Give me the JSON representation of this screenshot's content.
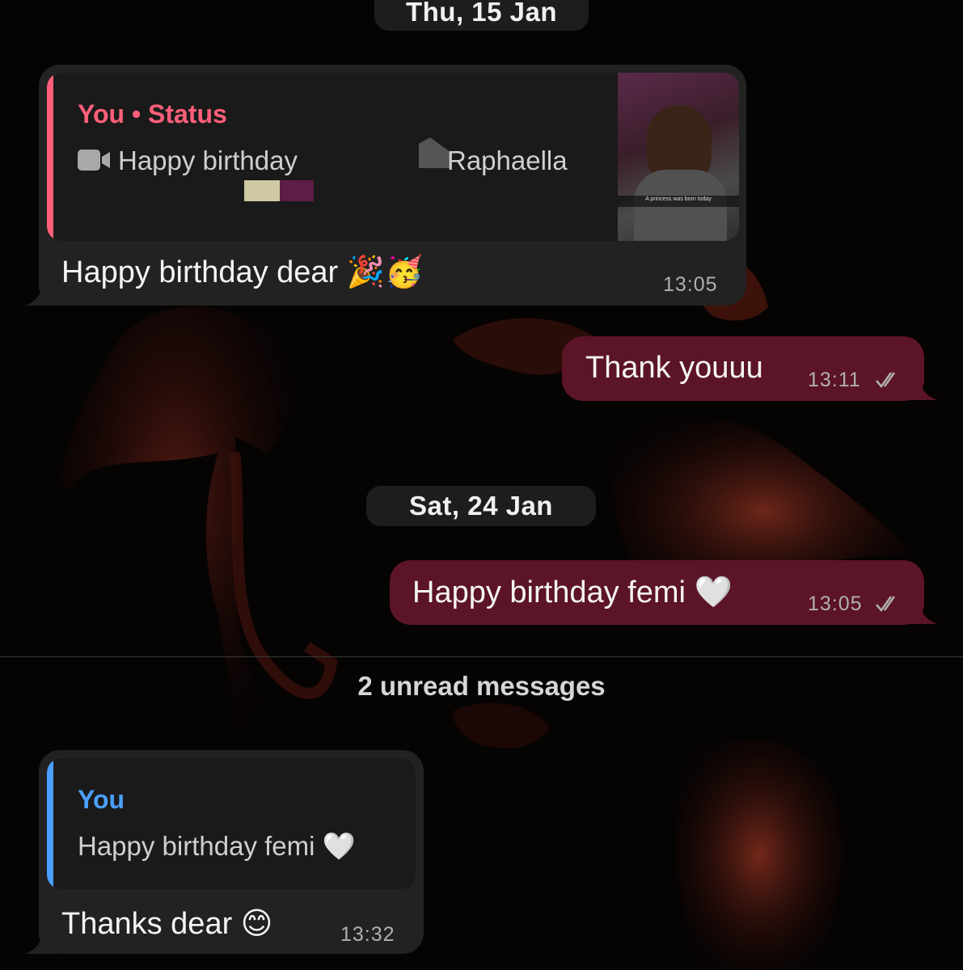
{
  "date_separators": [
    "Thu, 15 Jan",
    "Sat, 24 Jan"
  ],
  "messages": [
    {
      "direction": "incoming",
      "quote": {
        "author": "You • Status",
        "text_prefix": "Happy birthday",
        "text_suffix": "Raphaella",
        "thumbnail_caption": "A princess was born today",
        "accent_color": "#ff5f7a"
      },
      "text": "Happy birthday dear 🎉🥳",
      "time": "13:05"
    },
    {
      "direction": "outgoing",
      "text": "Thank youuu",
      "time": "13:11"
    },
    {
      "direction": "outgoing",
      "text": "Happy birthday femi 🤍",
      "time": "13:05"
    },
    {
      "direction": "incoming",
      "quote": {
        "author": "You",
        "text": "Happy birthday femi 🤍",
        "accent_color": "#4a9fff"
      },
      "text": "Thanks dear 😊",
      "time": "13:32"
    }
  ],
  "unread_label": "2 unread messages",
  "icons": [
    "video-camera-icon",
    "double-check-icon",
    "thumbnail-image"
  ],
  "colors": {
    "incoming_bubble": "#222222",
    "outgoing_bubble": "#5c1427",
    "status_accent": "#ff5f7a",
    "reply_accent": "#4a9fff"
  }
}
